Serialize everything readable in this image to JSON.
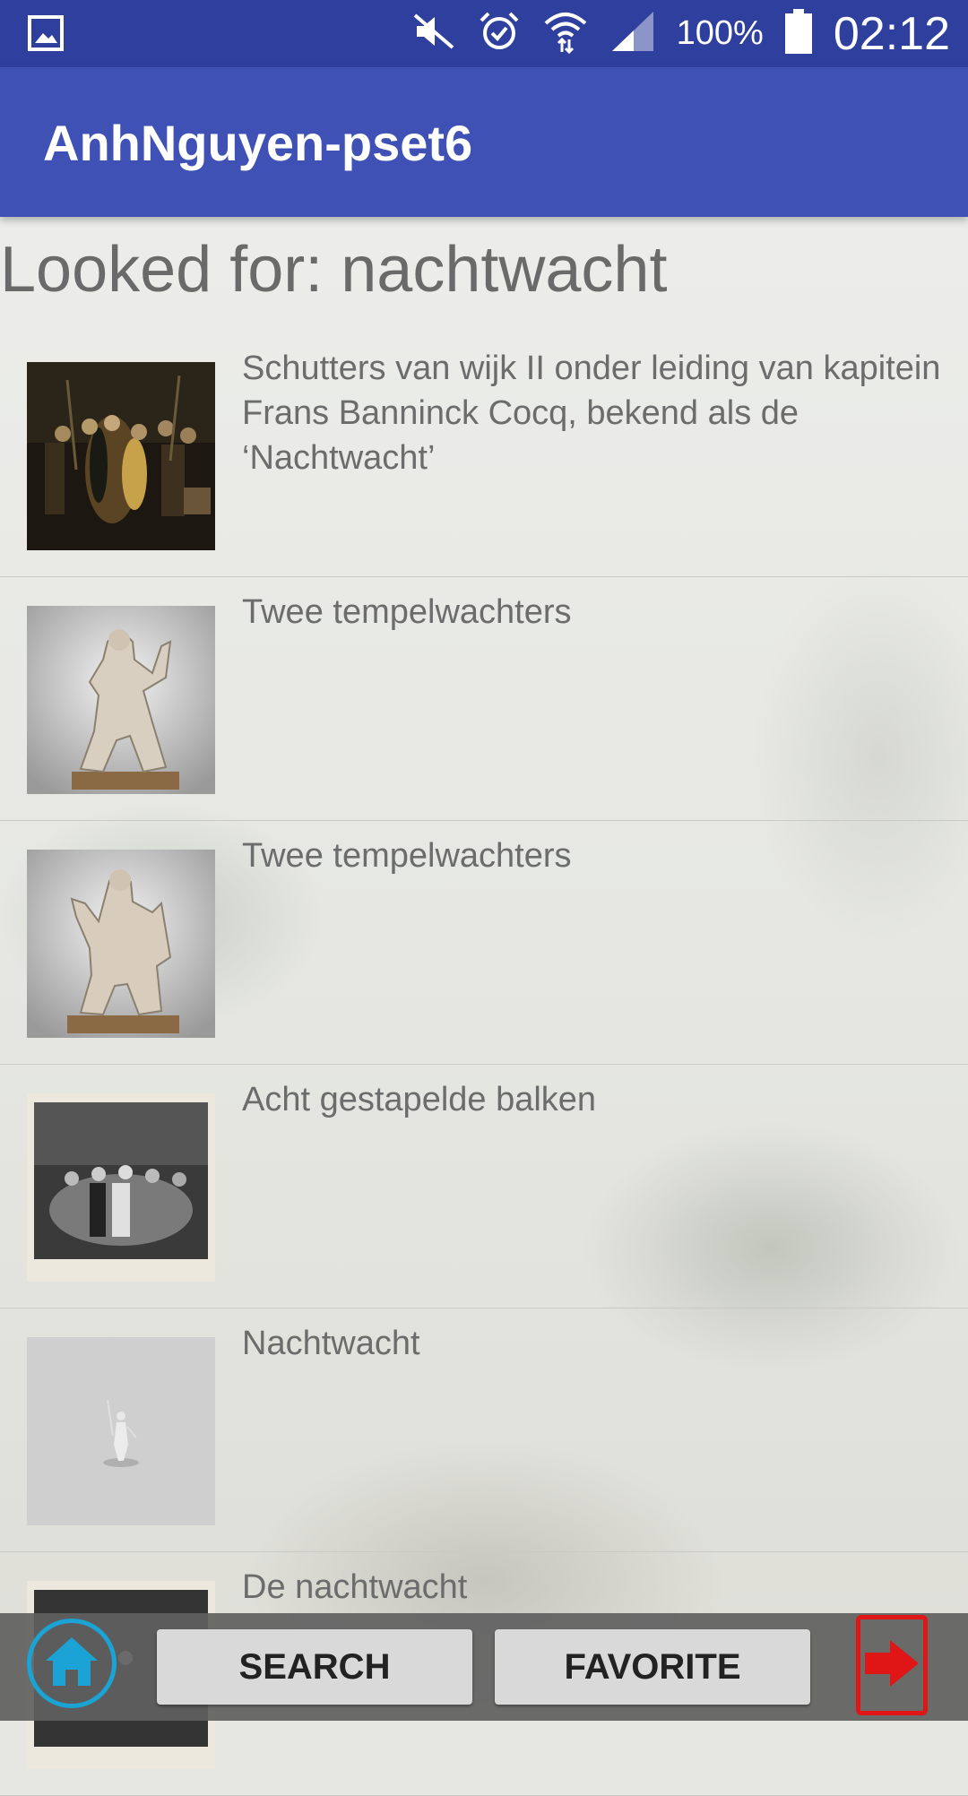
{
  "status_bar": {
    "battery_percent": "100%",
    "time": "02:12",
    "icons": [
      "gallery-icon",
      "mute-icon",
      "alarm-icon",
      "wifi-icon",
      "signal-icon",
      "battery-icon"
    ]
  },
  "app_bar": {
    "title": "AnhNguyen-pset6"
  },
  "search": {
    "heading": "Looked for: nachtwacht"
  },
  "results": [
    {
      "title": "Schutters van wijk II onder leiding van kapitein Frans Banninck Cocq, bekend als de ‘Nachtwacht’",
      "thumb": "night-watch-painting"
    },
    {
      "title": "Twee tempelwachters",
      "thumb": "temple-guardian-statue"
    },
    {
      "title": "Twee tempelwachters",
      "thumb": "temple-guardian-statue"
    },
    {
      "title": "Acht gestapelde balken",
      "thumb": "night-watch-print"
    },
    {
      "title": "Nachtwacht",
      "thumb": "silver-figurine"
    },
    {
      "title": "De nachtwacht",
      "thumb": "night-watch-print"
    }
  ],
  "bottom_nav": {
    "search_label": "SEARCH",
    "favorite_label": "FAVORITE",
    "icons": [
      "home-icon",
      "logout-icon"
    ]
  },
  "colors": {
    "status_bar": "#2f3f9e",
    "app_bar": "#3f51b5",
    "home_ring": "#1aa3d4",
    "logout_red": "#e01616"
  }
}
